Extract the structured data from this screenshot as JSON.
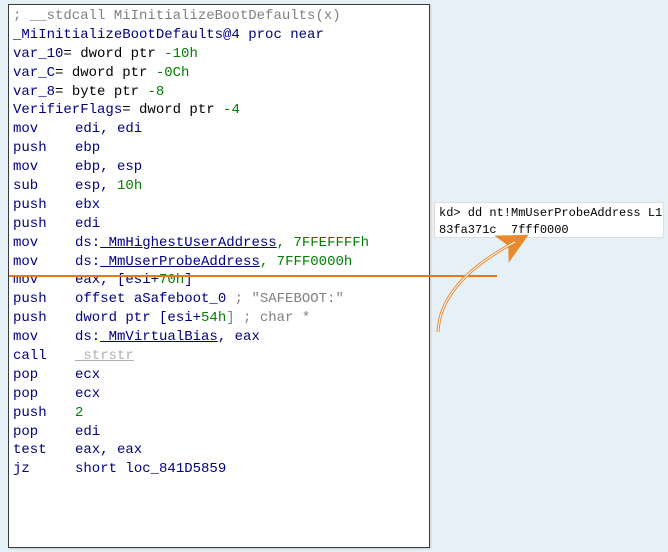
{
  "code": {
    "l0": "; __stdcall MiInitializeBootDefaults(x)",
    "l1_a": "_MiInitializeBootDefaults@4",
    "l1_b": " proc near",
    "blank1": "",
    "l3_a": "var_10",
    "l3_b": "= dword ptr ",
    "l3_c": "-10h",
    "l4_a": "var_C",
    "l4_b": "= dword ptr ",
    "l4_c": "-0Ch",
    "l5_a": "var_8",
    "l5_b": "= byte ptr ",
    "l5_c": "-8",
    "l6_a": "VerifierFlags",
    "l6_b": "= dword ptr ",
    "l6_c": "-4",
    "blank2": "",
    "m_mov": "mov",
    "m_push": "push",
    "m_sub": "sub",
    "m_call": "call",
    "m_pop": "pop",
    "m_test": "test",
    "m_jz": "jz",
    "r_edi_edi": "edi, edi",
    "r_ebp": "ebp",
    "r_ebp_esp": "ebp, esp",
    "r_esp": "esp, ",
    "n_10h": "10h",
    "r_ebx": "ebx",
    "r_edi": "edi",
    "ds": "ds:",
    "sym_hi": "_MmHighestUserAddress",
    "n_hi": ", 7FFEFFFFh",
    "sym_probe": "_MmUserProbeAddress",
    "n_probe": ", 7FFF0000h",
    "eax_esi70": "eax, [esi+",
    "n_70h": "70h",
    "close": "]",
    "off": "offset ",
    "safelbl": "aSafeboot_0",
    "safecmt": " ; \"SAFEBOOT:\"",
    "dptr": "dword ptr [esi+",
    "n_54h": "54h",
    "charcmt": "] ; char *",
    "sym_bias": "_MmVirtualBias",
    "comma_eax": ", eax",
    "strstr": "_strstr",
    "r_ecx": "ecx",
    "n_2": "2",
    "eax_eax": "eax, eax",
    "short": "short ",
    "loc": "loc_841D5859"
  },
  "callout": {
    "line1": "kd> dd nt!MmUserProbeAddress L1",
    "line2": "83fa371c  7fff0000"
  }
}
